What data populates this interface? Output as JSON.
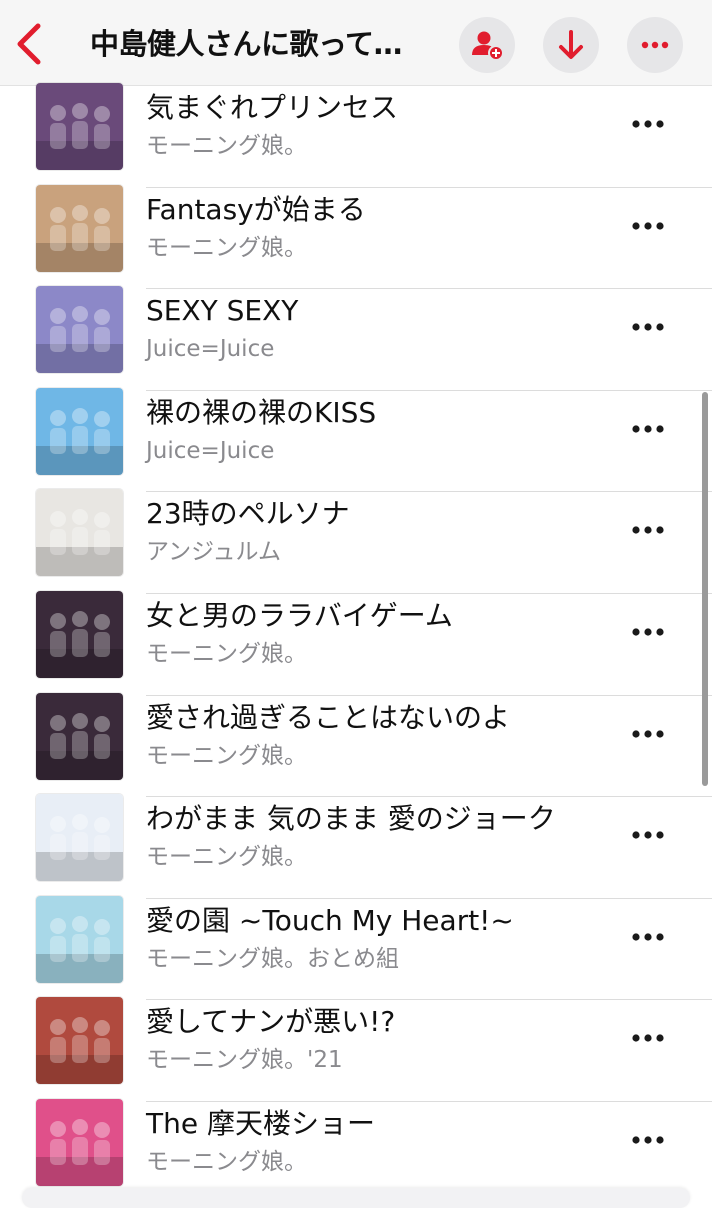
{
  "header": {
    "back_icon": "chevron-left-icon",
    "title": "中島健人さんに歌って…",
    "accent_color": "#e11d2e",
    "buttons": [
      {
        "name": "add-person-icon"
      },
      {
        "name": "download-arrow-icon"
      },
      {
        "name": "more-ellipsis-icon"
      }
    ]
  },
  "songs": [
    {
      "title": "気まぐれプリンセス",
      "artist": "モーニング娘。",
      "art_color": "#6a4a7a"
    },
    {
      "title": "Fantasyが始まる",
      "artist": "モーニング娘。",
      "art_color": "#c9a27d"
    },
    {
      "title": "SEXY SEXY",
      "artist": "Juice=Juice",
      "art_color": "#8c88c8"
    },
    {
      "title": "裸の裸の裸のKISS",
      "artist": "Juice=Juice",
      "art_color": "#6fb7e6"
    },
    {
      "title": "23時のペルソナ",
      "artist": "アンジュルム",
      "art_color": "#e8e6e2"
    },
    {
      "title": "女と男のララバイゲーム",
      "artist": "モーニング娘。",
      "art_color": "#3a2a3a"
    },
    {
      "title": "愛され過ぎることはないのよ",
      "artist": "モーニング娘。",
      "art_color": "#3a2a3a"
    },
    {
      "title": "わがまま 気のまま 愛のジョーク",
      "artist": "モーニング娘。",
      "art_color": "#e8eef6"
    },
    {
      "title": "愛の園 ~Touch My Heart!~",
      "artist": "モーニング娘。おとめ組",
      "art_color": "#a8d8e8"
    },
    {
      "title": "愛してナンが悪い!?",
      "artist": "モーニング娘。'21",
      "art_color": "#b04a3e"
    },
    {
      "title": "The 摩天楼ショー",
      "artist": "モーニング娘。",
      "art_color": "#e0508a"
    }
  ]
}
